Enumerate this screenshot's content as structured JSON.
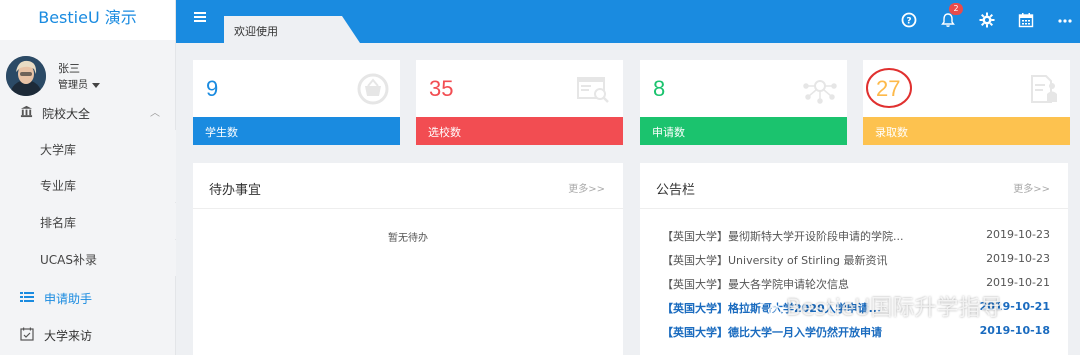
{
  "app": {
    "brand": "BestieU 演示"
  },
  "user": {
    "name": "张三",
    "role": "管理员"
  },
  "sidebar": {
    "group": {
      "label": "院校大全",
      "icon": "institution-icon"
    },
    "sub_items": [
      {
        "label": "大学库"
      },
      {
        "label": "专业库"
      },
      {
        "label": "排名库"
      },
      {
        "label": "UCAS补录"
      }
    ],
    "items": [
      {
        "label": "申请助手",
        "icon": "list-icon",
        "active": true
      },
      {
        "label": "大学来访",
        "icon": "calendar-check-icon",
        "active": false
      }
    ]
  },
  "header": {
    "tab_label": "欢迎使用",
    "notification_count": "2",
    "icons": [
      "help-icon",
      "bell-icon",
      "gear-icon",
      "calendar-icon",
      "more-icon"
    ]
  },
  "stats": [
    {
      "value": "9",
      "label": "学生数",
      "color": "#1a8be0",
      "icon": "basket-icon"
    },
    {
      "value": "35",
      "label": "选校数",
      "color": "#f24d52",
      "icon": "browser-search-icon"
    },
    {
      "value": "8",
      "label": "申请数",
      "color": "#1bc36e",
      "icon": "network-icon"
    },
    {
      "value": "27",
      "label": "录取数",
      "color": "#fdc24f",
      "icon": "document-person-icon"
    }
  ],
  "todo": {
    "title": "待办事宜",
    "more": "更多>>",
    "empty": "暂无待办"
  },
  "notice": {
    "title": "公告栏",
    "more": "更多>>",
    "items": [
      {
        "text": "【英国大学】曼彻斯特大学开设阶段申请的学院...",
        "date": "2019-10-23",
        "bold": false
      },
      {
        "text": "【英国大学】University of Stirling 最新资讯",
        "date": "2019-10-23",
        "bold": false
      },
      {
        "text": "【英国大学】曼大各学院申请轮次信息",
        "date": "2019-10-21",
        "bold": false
      },
      {
        "text": "【英国大学】格拉斯哥大学2020入学申请...",
        "date": "2019-10-21",
        "bold": true
      },
      {
        "text": "【英国大学】德比大学一月入学仍然开放申请",
        "date": "2019-10-18",
        "bold": true
      }
    ]
  },
  "watermark": "BestieU国际升学指导"
}
